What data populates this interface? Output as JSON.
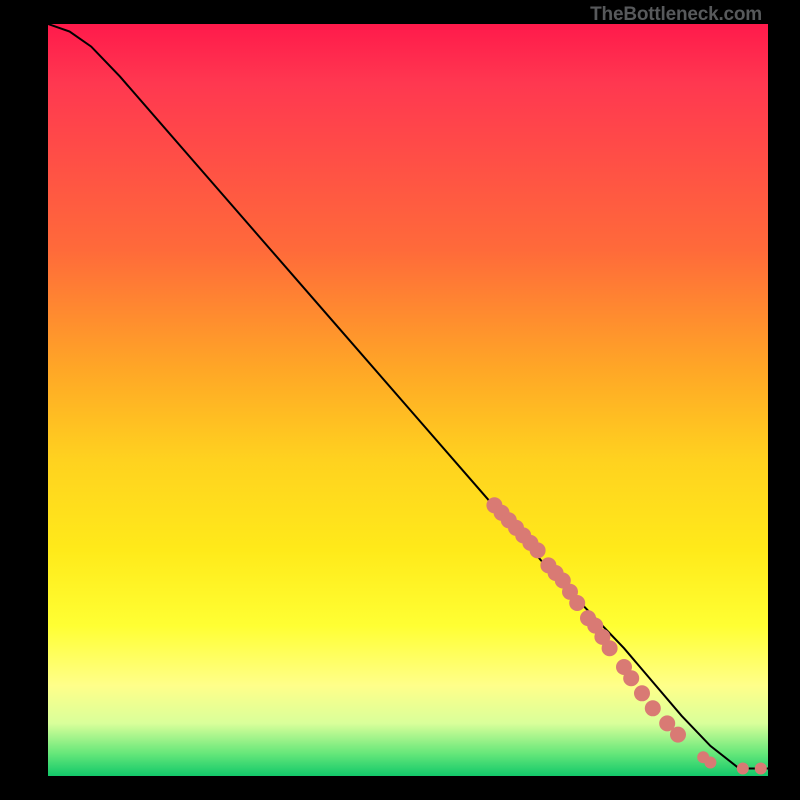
{
  "watermark": "TheBottleneck.com",
  "chart_data": {
    "type": "line",
    "title": "",
    "xlabel": "",
    "ylabel": "",
    "xlim": [
      0,
      100
    ],
    "ylim": [
      0,
      100
    ],
    "grid": false,
    "legend": false,
    "gradient_stops": [
      {
        "pos": 0,
        "color": "#ff1a4b"
      },
      {
        "pos": 30,
        "color": "#ff6a3a"
      },
      {
        "pos": 58,
        "color": "#ffd21f"
      },
      {
        "pos": 80,
        "color": "#ffff33"
      },
      {
        "pos": 93,
        "color": "#d9ff9a"
      },
      {
        "pos": 100,
        "color": "#12c86a"
      }
    ],
    "series": [
      {
        "name": "curve",
        "x": [
          0,
          3,
          6,
          10,
          20,
          30,
          40,
          50,
          60,
          70,
          80,
          88,
          92,
          96,
          100
        ],
        "y": [
          100,
          99,
          97,
          93,
          82,
          71,
          60,
          49,
          38,
          27,
          17,
          8,
          4,
          1,
          1
        ]
      }
    ],
    "points": [
      {
        "x": 62,
        "y": 36
      },
      {
        "x": 63,
        "y": 35
      },
      {
        "x": 64,
        "y": 34
      },
      {
        "x": 65,
        "y": 33
      },
      {
        "x": 66,
        "y": 32
      },
      {
        "x": 67,
        "y": 31
      },
      {
        "x": 68,
        "y": 30
      },
      {
        "x": 69.5,
        "y": 28
      },
      {
        "x": 70.5,
        "y": 27
      },
      {
        "x": 71.5,
        "y": 26
      },
      {
        "x": 72.5,
        "y": 24.5
      },
      {
        "x": 73.5,
        "y": 23
      },
      {
        "x": 75,
        "y": 21
      },
      {
        "x": 76,
        "y": 20
      },
      {
        "x": 77,
        "y": 18.5
      },
      {
        "x": 78,
        "y": 17
      },
      {
        "x": 80,
        "y": 14.5
      },
      {
        "x": 81,
        "y": 13
      },
      {
        "x": 82.5,
        "y": 11
      },
      {
        "x": 84,
        "y": 9
      },
      {
        "x": 86,
        "y": 7
      },
      {
        "x": 87.5,
        "y": 5.5
      },
      {
        "x": 91,
        "y": 2.5
      },
      {
        "x": 92,
        "y": 1.8
      },
      {
        "x": 96.5,
        "y": 1
      },
      {
        "x": 99,
        "y": 1
      }
    ]
  }
}
